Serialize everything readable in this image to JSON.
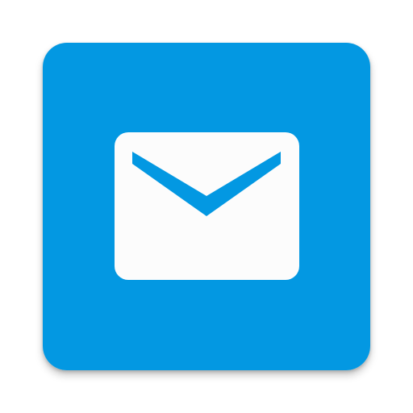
{
  "app_icon": {
    "icon_name": "mail-envelope-icon",
    "tile_color": "#0398e2",
    "glyph_color": "#fcfcfc"
  }
}
